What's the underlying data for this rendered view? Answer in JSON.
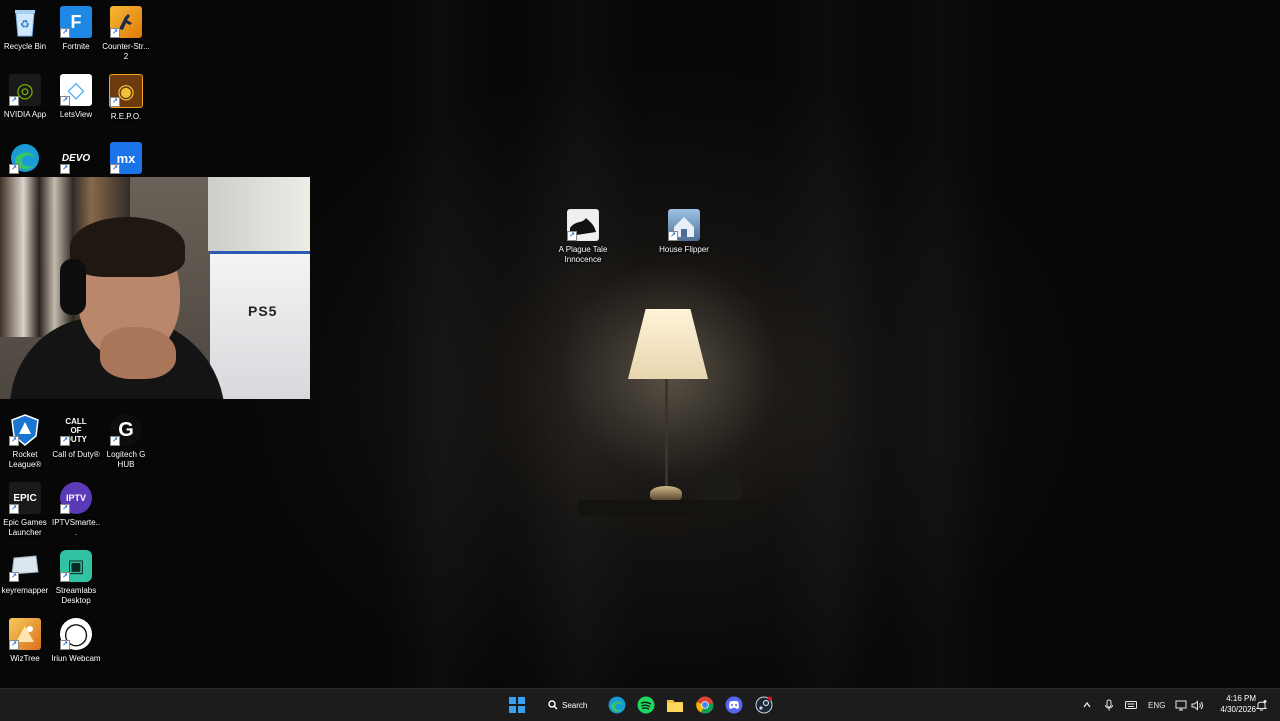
{
  "desktop": {
    "icons": [
      {
        "label": "Recycle Bin",
        "icon": "recycle-bin-icon",
        "color": "#2a7ac7"
      },
      {
        "label": "Fortnite",
        "icon": "fortnite-icon",
        "color": "#1e88e5"
      },
      {
        "label": "Counter-Str... 2",
        "icon": "counter-strike-icon",
        "color": "#f39c12"
      },
      {
        "label": "NVIDIA App",
        "icon": "nvidia-icon",
        "color": "#76b900"
      },
      {
        "label": "LetsView",
        "icon": "letsview-icon",
        "color": "#3fa9f5"
      },
      {
        "label": "R.E.P.O.",
        "icon": "repo-icon",
        "color": "#c58a10"
      },
      {
        "label": "Microsoft Edge",
        "icon": "edge-icon",
        "color": "#1a9bd7"
      },
      {
        "label": "DEVO",
        "icon": "devo-icon",
        "color": "#111111"
      },
      {
        "label": "MX",
        "icon": "mx-icon",
        "color": "#1a73e8"
      },
      {
        "label": "Rocket League®",
        "icon": "rocket-league-icon",
        "color": "#1976d2"
      },
      {
        "label": "Call of Duty®",
        "icon": "call-of-duty-icon",
        "color": "#111111"
      },
      {
        "label": "Logitech G HUB",
        "icon": "logitech-icon",
        "color": "#0d0d0d"
      },
      {
        "label": "Epic Games Launcher",
        "icon": "epic-games-icon",
        "color": "#1a1a1a"
      },
      {
        "label": "IPTVSmarte...",
        "icon": "iptv-icon",
        "color": "#5b3ab8"
      },
      {
        "label": "keyremapper",
        "icon": "keyremapper-icon",
        "color": "#dce6ee"
      },
      {
        "label": "Streamlabs Desktop",
        "icon": "streamlabs-icon",
        "color": "#31c3a2"
      },
      {
        "label": "WizTree",
        "icon": "wiztree-icon",
        "color": "#e8a23a"
      },
      {
        "label": "Iriun Webcam",
        "icon": "iriun-webcam-icon",
        "color": "#111111"
      },
      {
        "label": "A Plague Tale Innocence",
        "icon": "plague-tale-icon",
        "color": "#dddddd"
      },
      {
        "label": "House Flipper",
        "icon": "house-flipper-icon",
        "color": "#6d8fb4"
      }
    ],
    "icon_glyphs": {
      "fortnite": "F",
      "nvidia": "◎",
      "letsview": "◇",
      "repo": "◉",
      "devo": "DEVO",
      "mx": "mx",
      "call_of_duty": "CALL OF DUTY",
      "logitech": "G",
      "epic": "EPIC",
      "iptv": "IPTV",
      "streamlabs": "▣",
      "iriun": "◯"
    }
  },
  "webcam": {
    "box_text": "PS5"
  },
  "taskbar": {
    "search_label": "Search",
    "pinned": [
      "start-button",
      "search-button",
      "edge",
      "spotify",
      "file-explorer",
      "chrome",
      "discord",
      "steam"
    ],
    "language": "ENG",
    "time": "4:16 PM",
    "date": "4/30/2026"
  },
  "colors": {
    "taskbar_bg": "#1c1c1c",
    "windows_blue": "#3aa0f0"
  }
}
